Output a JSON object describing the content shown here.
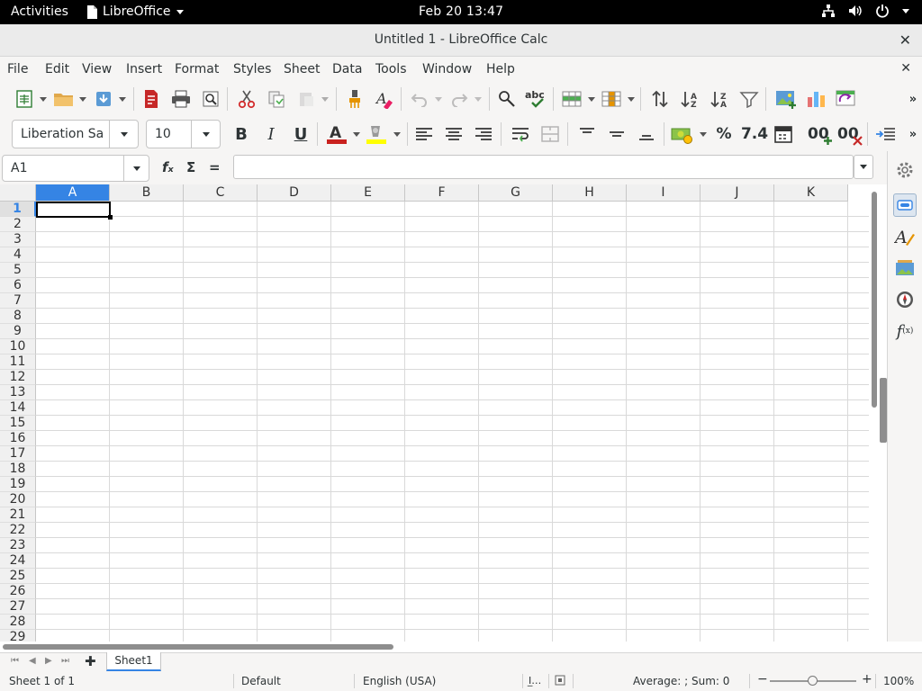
{
  "topbar": {
    "activities": "Activities",
    "app_name": "LibreOffice",
    "clock": "Feb 20  13:47"
  },
  "window": {
    "title": "Untitled 1 - LibreOffice Calc",
    "close": "✕"
  },
  "menu": {
    "items": [
      "File",
      "Edit",
      "View",
      "Insert",
      "Format",
      "Styles",
      "Sheet",
      "Data",
      "Tools",
      "Window",
      "Help"
    ],
    "close_doc": "✕"
  },
  "format_bar": {
    "font_name": "Liberation Sa",
    "font_size": "10",
    "bold": "B",
    "italic": "I",
    "underline": "U",
    "percent": "%",
    "number": "7.4",
    "add_decimal": "00",
    "del_decimal": "00"
  },
  "formula_bar": {
    "name_box": "A1",
    "fx": "fₓ",
    "sigma": "Σ",
    "equals": "=",
    "content": ""
  },
  "grid": {
    "columns": [
      "A",
      "B",
      "C",
      "D",
      "E",
      "F",
      "G",
      "H",
      "I",
      "J",
      "K"
    ],
    "rows": [
      "1",
      "2",
      "3",
      "4",
      "5",
      "6",
      "7",
      "8",
      "9",
      "10",
      "11",
      "12",
      "13",
      "14",
      "15",
      "16",
      "17",
      "18",
      "19",
      "20",
      "21",
      "22",
      "23",
      "24",
      "25",
      "26",
      "27",
      "28",
      "29"
    ],
    "selected_column": "A",
    "selected_row": "1"
  },
  "sheets": {
    "tabs": [
      "Sheet1"
    ]
  },
  "status": {
    "sheet_info": "Sheet 1 of 1",
    "page_style": "Default",
    "language": "English (USA)",
    "selection_summary": "Average: ; Sum: 0",
    "zoom_minus": "−",
    "zoom_plus": "+",
    "zoom": "100%",
    "zoom_fraction": 0.5
  },
  "colors": {
    "accent": "#3584e4",
    "chrome": "#f6f5f4",
    "topbar": "#000000"
  }
}
